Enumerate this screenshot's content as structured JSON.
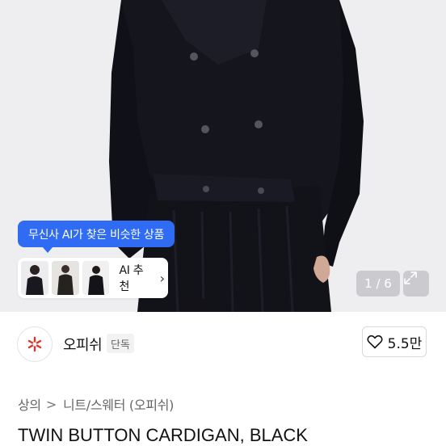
{
  "ai_recommend": {
    "bubble_text": "무신사 AI가 찾은 비슷한 상품",
    "card_label": "AI 추천",
    "chevron": "›"
  },
  "gallery": {
    "counter": "1 / 6",
    "expand_icon": "expand-icon"
  },
  "brand": {
    "name": "오피쉬",
    "badge": "단독",
    "logo_icon": "asterisk-flower-logo",
    "logo_color": "#e0322b"
  },
  "like": {
    "count": "5.5만",
    "icon": "heart-outline-icon"
  },
  "breadcrumb": {
    "items": [
      "상의",
      "니트/스웨터 (오피쉬)"
    ],
    "separator": ">"
  },
  "product": {
    "title": "TWIN BUTTON CARDIGAN, BLACK"
  },
  "colors": {
    "accent": "#2f6bf3",
    "garment": "#14141c"
  }
}
